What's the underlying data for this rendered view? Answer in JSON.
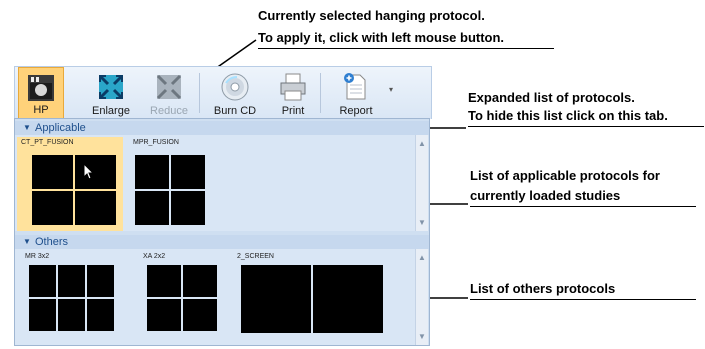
{
  "annotations": {
    "selected_line1": "Currently selected hanging protocol.",
    "selected_line2": "To apply it, click with left mouse button.",
    "expanded_line1": "Expanded list of protocols.",
    "expanded_line2": "To hide this list click on this tab.",
    "applicable_line1": "List of applicable protocols for",
    "applicable_line2": "currently loaded studies",
    "others_line1": "List of others protocols"
  },
  "toolbar": {
    "hp_label": "HP",
    "enlarge_label": "Enlarge",
    "reduce_label": "Reduce",
    "burncd_label": "Burn CD",
    "print_label": "Print",
    "report_label": "Report"
  },
  "sections": {
    "applicable_title": "Applicable",
    "others_title": "Others"
  },
  "protocols": {
    "applicable": [
      "CT_PT_FUSION",
      "MPR_FUSION"
    ],
    "others": [
      "MR 3x2",
      "XA 2x2",
      "2_SCREEN"
    ]
  },
  "colors": {
    "selected_bg": "#ffd27a",
    "panel_bg": "#d9e6f5",
    "header_text": "#1e4f8c"
  }
}
